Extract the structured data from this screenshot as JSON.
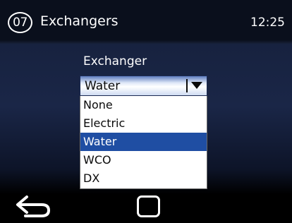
{
  "header": {
    "screen_number": "07",
    "title": "Exchangers",
    "time": "12:25"
  },
  "form": {
    "label": "Exchanger",
    "selected_value": "Water",
    "options": [
      "None",
      "Electric",
      "Water",
      "WCO",
      "DX"
    ]
  },
  "footer": {
    "back_icon": "back-arrow-icon",
    "home_icon": "square-button-icon"
  },
  "colors": {
    "selection": "#1f4ea3",
    "header_bg": "#0a0f1c"
  }
}
